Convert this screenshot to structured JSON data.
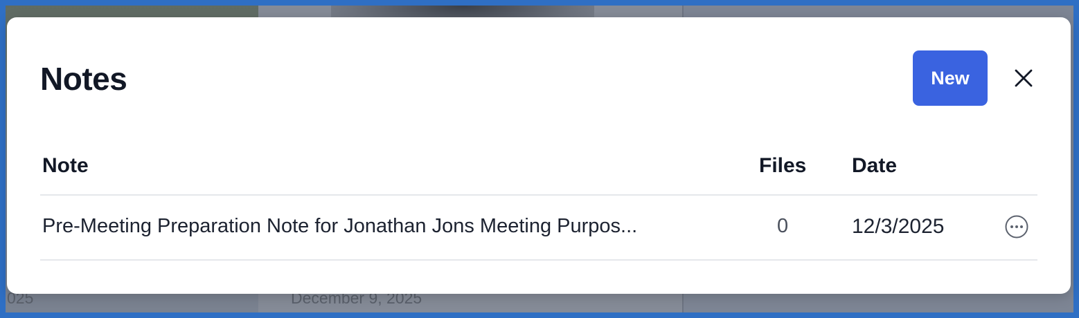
{
  "background": {
    "text_left": "025",
    "text_mid": "December 9, 2025"
  },
  "modal": {
    "title": "Notes",
    "new_label": "New",
    "close_icon": "close-icon"
  },
  "table": {
    "columns": [
      "Note",
      "Files",
      "Date"
    ],
    "rows": [
      {
        "note": "Pre-Meeting Preparation Note for Jonathan Jons Meeting Purpos...",
        "files": "0",
        "date": "12/3/2025",
        "actions_icon": "more-horizontal-icon"
      }
    ]
  },
  "colors": {
    "accent": "#3a63e0",
    "title": "#121826",
    "divider": "#e5e7eb"
  }
}
